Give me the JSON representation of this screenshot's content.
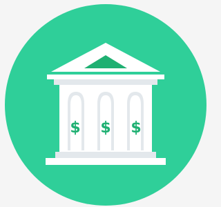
{
  "icon": {
    "name": "bank-icon",
    "columns": [
      {
        "symbol": "$"
      },
      {
        "symbol": "$"
      },
      {
        "symbol": "$"
      }
    ]
  },
  "colors": {
    "background": "#f5f5f5",
    "circle": "#2fcf99",
    "building": "#ffffff",
    "building_shade": "#e3e8ec",
    "accent": "#1fb072"
  }
}
